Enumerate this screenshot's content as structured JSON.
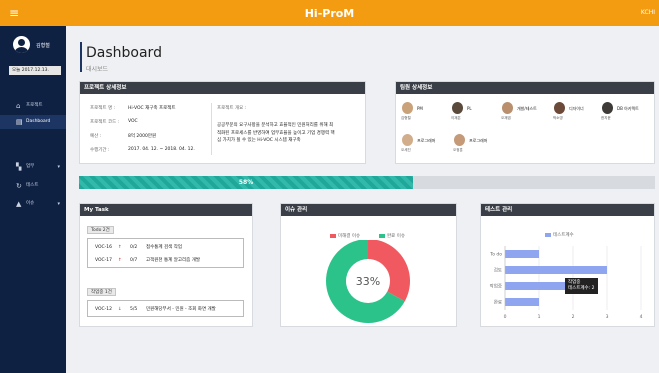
{
  "header": {
    "menu_icon": "≡",
    "title": "Hi-ProM",
    "right_text": "KCHI",
    "brand_color": "#f39c12"
  },
  "sidebar": {
    "user_name": "김형철",
    "date": "오늘 2017.12.13.",
    "items": [
      {
        "icon": "home-icon",
        "glyph": "⌂",
        "label": "프로젝트"
      },
      {
        "icon": "dashboard-icon",
        "glyph": "▤",
        "label": "Dashboard"
      },
      {
        "icon": "tasks-icon",
        "glyph": "▚",
        "label": "업무"
      },
      {
        "icon": "test-icon",
        "glyph": "↻",
        "label": "테스트"
      },
      {
        "icon": "issue-icon",
        "glyph": "▲",
        "label": "이슈"
      }
    ]
  },
  "page": {
    "title": "Dashboard",
    "subtitle": "대시보드"
  },
  "project": {
    "header": "프로젝트 상세정보",
    "fields": [
      {
        "label": "프로젝트 명 :",
        "value": "Hi-VOC 재구축 프로젝트"
      },
      {
        "label": "프로젝트 코드 :",
        "value": "VOC"
      },
      {
        "label": "예산 :",
        "value": "8억 2000만원"
      },
      {
        "label": "수행기간 :",
        "value": "2017. 04. 12. ~ 2018. 04. 12."
      }
    ],
    "desc_label": "프로젝트 개요 :",
    "description": "공공부문의 요구사항을 분석하고 효율적인 민원처리를 위해 최적화된 프로세스를 반영하여 업무효율을 높이고 기업 경쟁력 핵심 가치가 될 수 있는 Hi-VOC 시스템 재구축"
  },
  "team": {
    "header": "팀원 상세정보",
    "members": [
      {
        "role": "PM",
        "name": "김형철"
      },
      {
        "role": "PL",
        "name": "이재은"
      },
      {
        "role": "개발/테스트",
        "name": "오재엽"
      },
      {
        "role": "디자이너",
        "name": "박소영"
      },
      {
        "role": "DB 아키텍트",
        "name": "한지윤"
      },
      {
        "role": "프로그래머",
        "name": "오세진"
      },
      {
        "role": "프로그래머",
        "name": "오정훈"
      }
    ]
  },
  "progress": {
    "percent": 58,
    "label": "58%"
  },
  "mytask": {
    "header": "My Task",
    "groups": [
      {
        "label": "Todo 2건",
        "rows": [
          {
            "code": "VOC-16",
            "arrow": "↑",
            "arrow_color": "#27ae60",
            "count": "0/2",
            "title": "접수통계 검색 작업"
          },
          {
            "code": "VOC-17",
            "arrow": "↑",
            "arrow_color": "#e74c3c",
            "count": "0/7",
            "title": "고객원천 통계 알고리즘 개발"
          }
        ]
      },
      {
        "label": "작업중 1건",
        "rows": [
          {
            "code": "VOC-12",
            "arrow": "↓",
            "arrow_color": "#27ae60",
            "count": "5/5",
            "title": "민원해당부서 - 민원 - 조회 화면 개발"
          }
        ]
      }
    ]
  },
  "issues": {
    "header": "이슈 관리",
    "center_label": "33%",
    "legend": [
      {
        "label": "미해결 이슈",
        "color": "#f0595f"
      },
      {
        "label": "완료 이슈",
        "color": "#2cc38a"
      }
    ],
    "chart_data": {
      "type": "pie",
      "categories": [
        "미해결 이슈",
        "완료 이슈"
      ],
      "values": [
        33,
        67
      ]
    }
  },
  "tests": {
    "header": "테스트 관리",
    "legend": "테스트계수",
    "bar_color": "#8fa5f0",
    "tooltip_title": "작업중",
    "tooltip_value": "테스트계수: 2",
    "chart_data": {
      "type": "bar",
      "orientation": "horizontal",
      "categories": [
        "To do",
        "검토",
        "작업중",
        "완료"
      ],
      "series": [
        {
          "name": "테스트계수",
          "values": [
            1,
            3,
            2,
            1
          ]
        }
      ],
      "xlim": [
        0,
        4
      ],
      "xticks": [
        "0",
        "1",
        "2",
        "3",
        "4"
      ],
      "grid": true
    }
  }
}
